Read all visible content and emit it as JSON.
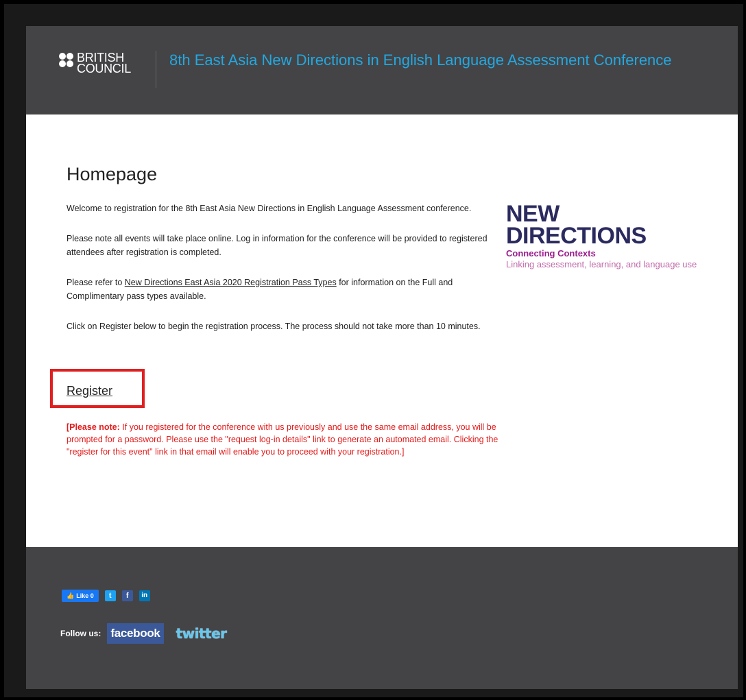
{
  "header": {
    "logo_line1": "BRITISH",
    "logo_line2": "COUNCIL",
    "title": "8th East Asia New Directions in English Language Assessment Conference"
  },
  "main": {
    "page_title": "Homepage",
    "para1": "Welcome to registration for the 8th East Asia New Directions in English Language Assessment conference.",
    "para2": "Please note all events will take place online. Log in information for the conference will be provided to registered attendees after registration is completed.",
    "para3_before": "Please refer to ",
    "para3_link": "New Directions East Asia 2020 Registration Pass Types",
    "para3_after": " for information on the Full and Complimentary pass types available.",
    "para4": "Click on Register below to begin the registration process. The process should not take more than 10 minutes.",
    "register_label": "Register",
    "note_bold": "[Please note:",
    "note_text": " If you registered for the conference with us previously and use the same email address, you will be prompted for a password. Please use the \"request log-in details\" link to generate an automated email. Clicking the \"register for this event\" link in that email will enable you to proceed with your registration.]"
  },
  "side_logo": {
    "line1": "NEW",
    "line2": "DIRECTIONS",
    "sub1": "Connecting Contexts",
    "sub2": "Linking assessment, learning, and language use"
  },
  "footer": {
    "like_label": "Like 0",
    "twitter_small": "t",
    "facebook_small": "f",
    "linkedin_small": "in",
    "follow_label": "Follow us:",
    "facebook_label": "facebook",
    "twitter_label": "twitter"
  },
  "colors": {
    "header_bg": "#444447",
    "title_blue": "#23a8e0",
    "note_red": "#e41b1b",
    "highlight_box": "#e02020",
    "nd_navy": "#2b2a5f",
    "nd_magenta": "#9c1d8e"
  }
}
